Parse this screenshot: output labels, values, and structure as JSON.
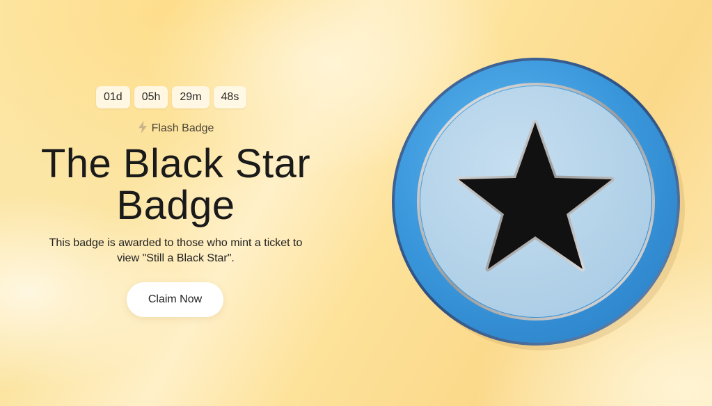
{
  "countdown": {
    "days": "01d",
    "hours": "05h",
    "minutes": "29m",
    "seconds": "48s"
  },
  "badge_type": {
    "icon": "lightning-bolt-icon",
    "label": "Flash Badge"
  },
  "title": {
    "line1": "The Black Star",
    "line2": "Badge"
  },
  "description": {
    "line1": "This badge is awarded to those who mint a ticket to",
    "line2": "view \"Still a Black Star\"."
  },
  "cta": {
    "label": "Claim Now"
  },
  "colors": {
    "background": "#fde29a",
    "badge_outer_ring": "#3f9ee0",
    "badge_inner_face": "#b8d6ea",
    "badge_star": "#111111",
    "button": "#ffffff"
  }
}
